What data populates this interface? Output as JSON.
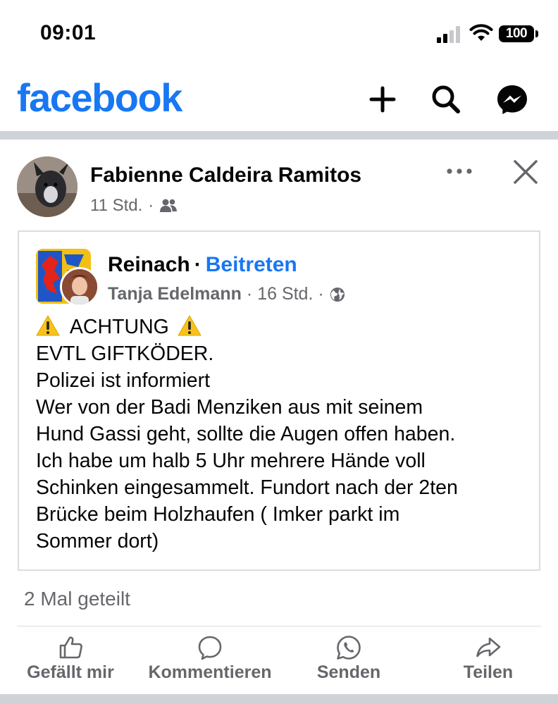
{
  "status_bar": {
    "time": "09:01",
    "battery": "100"
  },
  "header": {
    "logo": "facebook",
    "icons": [
      "plus-icon",
      "search-icon",
      "messenger-icon"
    ],
    "brand_color": "#1877f2"
  },
  "post": {
    "author": "Fabienne Caldeira Ramitos",
    "time": "11 Std.",
    "audience_icon": "friends-icon",
    "shared": {
      "group": "Reinach",
      "join_label": "Beitreten",
      "poster": "Tanja Edelmann",
      "time": "16 Std.",
      "audience_icon": "globe-icon",
      "lines": [
        "ACHTUNG",
        "EVTL GIFTKÖDER.",
        "Polizei ist informiert",
        "Wer von der Badi Menziken aus mit seinem",
        "Hund Gassi geht, sollte die Augen offen haben.",
        "Ich habe um halb 5 Uhr mehrere Hände voll",
        "Schinken eingesammelt. Fundort nach der 2ten",
        "Brücke beim Holzhaufen ( Imker parkt im",
        "Sommer dort)"
      ]
    },
    "share_count": "2 Mal geteilt"
  },
  "actions": {
    "like": "Gefällt mir",
    "comment": "Kommentieren",
    "send": "Senden",
    "share": "Teilen"
  },
  "colors": {
    "secondary_text": "#65676b",
    "divider": "#cfd3d8",
    "warning": "#f7c21a"
  }
}
